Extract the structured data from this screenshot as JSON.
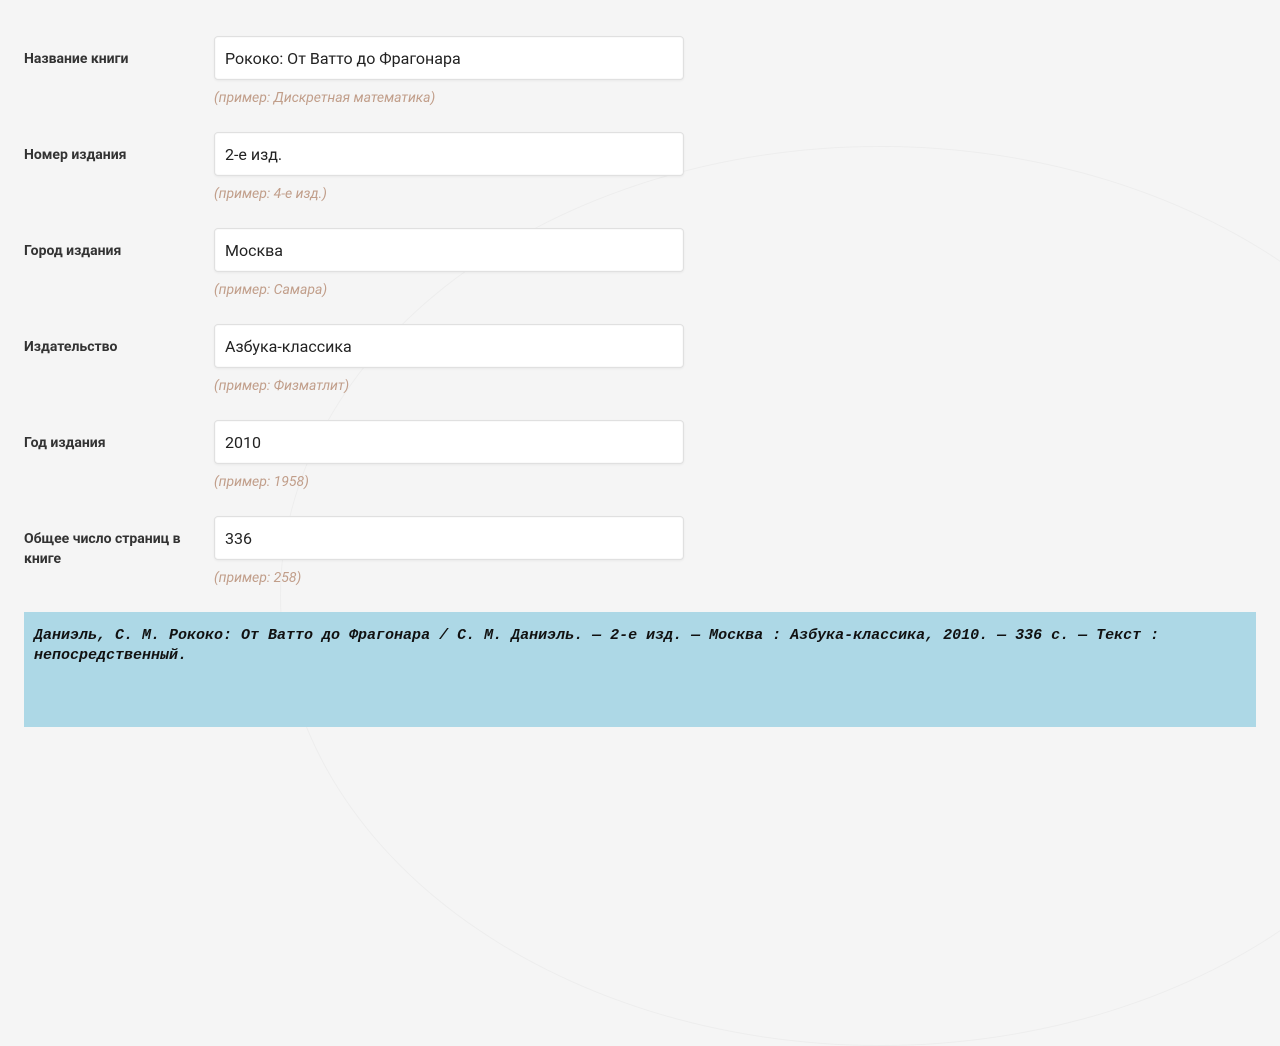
{
  "fields": [
    {
      "label": "Название книги",
      "value": "Рококо: От Ватто до Фрагонара",
      "hint": "(пример: Дискретная математика)"
    },
    {
      "label": "Номер издания",
      "value": "2-е изд.",
      "hint": "(пример: 4-е изд.)"
    },
    {
      "label": "Город издания",
      "value": "Москва",
      "hint": "(пример: Самара)"
    },
    {
      "label": "Издательство",
      "value": "Азбука-классика",
      "hint": "(пример: Физматлит)"
    },
    {
      "label": "Год издания",
      "value": "2010",
      "hint": "(пример: 1958)"
    },
    {
      "label": "Общее число страниц в книге",
      "value": "336",
      "hint": "(пример: 258)"
    }
  ],
  "result": "Даниэль, С. М. Рококо: От Ватто до Фрагонара / С. М. Даниэль. — 2-е изд. — Москва : Азбука-классика, 2010. — 336 с. — Текст : непосредственный."
}
